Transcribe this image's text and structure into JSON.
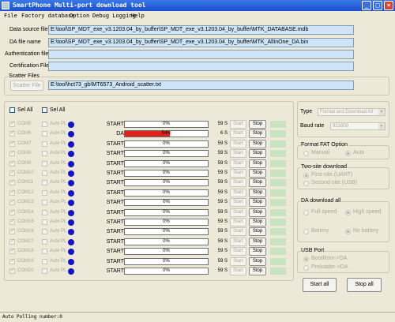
{
  "window": {
    "title": "SmartPhone Multi-port download tool",
    "minimize_icon": "minimize-icon",
    "maximize_icon": "maximize-icon",
    "close_icon": "close-icon"
  },
  "menu": [
    "File",
    "Factory database",
    "Option",
    "Debug Logging",
    "Help"
  ],
  "files": {
    "data_source_label": "Data source file",
    "data_source_value": "E:\\tool\\SP_MDT_exe_v3.1203.04_by_buffer\\SP_MDT_exe_v3.1203.04_by_buffer\\MTK_DATABASE.mdb",
    "da_label": "DA file name",
    "da_value": "E:\\tool\\SP_MDT_exe_v3.1203.04_by_buffer\\SP_MDT_exe_v3.1203.04_by_buffer\\MTK_AllInOne_DA.bin",
    "auth_label": "Authentication file",
    "auth_value": "",
    "cert_label": "Certification File",
    "cert_value": ""
  },
  "scatter": {
    "group_title": "Scatter Files",
    "button_label": "Scatter File",
    "value": "E:\\tool\\hct73_gb\\MT6573_Android_scatter.txt"
  },
  "ports_header": {
    "sel_all_1": "Sel All",
    "sel_all_2": "Sel All"
  },
  "ports": [
    {
      "com": "COM5",
      "auto": "Auto PL",
      "state": "START",
      "pct": "0%",
      "progress": 0,
      "secs": "59 S",
      "start": "Start",
      "stop": "Stop"
    },
    {
      "com": "COM6",
      "auto": "Auto PL",
      "state": "DA",
      "pct": "54%",
      "progress": 54,
      "secs": "6 S",
      "start": "Start",
      "stop": "Stop"
    },
    {
      "com": "COM7",
      "auto": "Auto PL",
      "state": "START",
      "pct": "0%",
      "progress": 0,
      "secs": "59 S",
      "start": "Start",
      "stop": "Stop"
    },
    {
      "com": "COM8",
      "auto": "Auto PL",
      "state": "START",
      "pct": "0%",
      "progress": 0,
      "secs": "59 S",
      "start": "Start",
      "stop": "Stop"
    },
    {
      "com": "COM9",
      "auto": "Auto PL",
      "state": "START",
      "pct": "0%",
      "progress": 0,
      "secs": "59 S",
      "start": "Start",
      "stop": "Stop"
    },
    {
      "com": "COM10",
      "auto": "Auto PL",
      "state": "START",
      "pct": "0%",
      "progress": 0,
      "secs": "59 S",
      "start": "Start",
      "stop": "Stop"
    },
    {
      "com": "COM11",
      "auto": "Auto PL",
      "state": "START",
      "pct": "0%",
      "progress": 0,
      "secs": "59 S",
      "start": "Start",
      "stop": "Stop"
    },
    {
      "com": "COM12",
      "auto": "Auto PL",
      "state": "START",
      "pct": "0%",
      "progress": 0,
      "secs": "59 S",
      "start": "Start",
      "stop": "Stop"
    },
    {
      "com": "COM13",
      "auto": "Auto PL",
      "state": "START",
      "pct": "0%",
      "progress": 0,
      "secs": "59 S",
      "start": "Start",
      "stop": "Stop"
    },
    {
      "com": "COM14",
      "auto": "Auto PL",
      "state": "START",
      "pct": "0%",
      "progress": 0,
      "secs": "59 S",
      "start": "Start",
      "stop": "Stop"
    },
    {
      "com": "COM15",
      "auto": "Auto PL",
      "state": "START",
      "pct": "0%",
      "progress": 0,
      "secs": "59 S",
      "start": "Start",
      "stop": "Stop"
    },
    {
      "com": "COM16",
      "auto": "Auto PL",
      "state": "START",
      "pct": "0%",
      "progress": 0,
      "secs": "59 S",
      "start": "Start",
      "stop": "Stop"
    },
    {
      "com": "COM17",
      "auto": "Auto PL",
      "state": "START",
      "pct": "0%",
      "progress": 0,
      "secs": "59 S",
      "start": "Start",
      "stop": "Stop"
    },
    {
      "com": "COM18",
      "auto": "Auto PL",
      "state": "START",
      "pct": "0%",
      "progress": 0,
      "secs": "59 S",
      "start": "Start",
      "stop": "Stop"
    },
    {
      "com": "COM19",
      "auto": "Auto PL",
      "state": "START",
      "pct": "0%",
      "progress": 0,
      "secs": "59 S",
      "start": "Start",
      "stop": "Stop"
    },
    {
      "com": "COM20",
      "auto": "Auto PL",
      "state": "START",
      "pct": "0%",
      "progress": 0,
      "secs": "59 S",
      "start": "Start",
      "stop": "Stop"
    }
  ],
  "right": {
    "type_label": "Type",
    "type_value": "Format and Download All",
    "baud_label": "Baud rate",
    "baud_value": "921600",
    "fat_title": "Format FAT Option",
    "fat_manual": "Manual",
    "fat_auto": "Auto",
    "twosite_title": "Two-site download",
    "twosite_first": "First-site (UART)",
    "twosite_second": "Second-site (USB)",
    "da_all_title": "DA download all",
    "full_speed": "Full speed",
    "high_speed": "High speed",
    "battery": "Battery",
    "no_battery": "No battery",
    "usb_title": "USB Port",
    "bootrom": "BootRom->DA",
    "preloader": "Preloader->DA",
    "start_all": "Start all",
    "stop_all": "Stop all"
  },
  "status": "Auto Polling number:0",
  "colors": {
    "progress": "#e0241c",
    "dot": "#1515c8",
    "titlebar": "#1c4fcf"
  }
}
